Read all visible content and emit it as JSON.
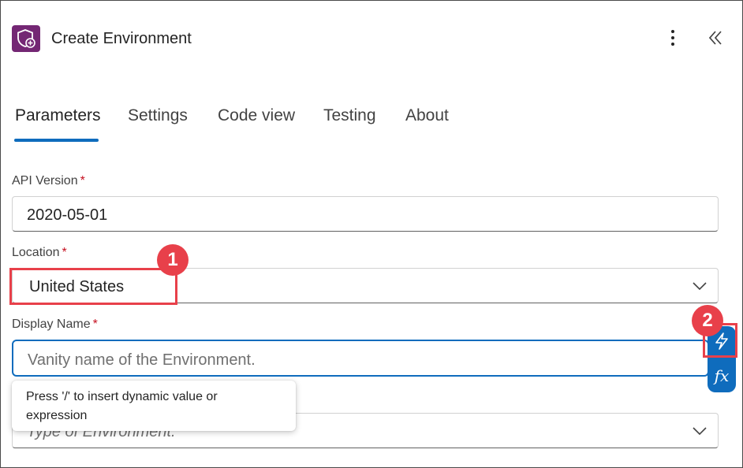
{
  "header": {
    "title": "Create Environment",
    "icon": "shield-add-icon",
    "more_icon": "more-vertical-icon",
    "collapse_icon": "double-chevron-left-icon"
  },
  "tabs": [
    {
      "label": "Parameters",
      "active": true
    },
    {
      "label": "Settings",
      "active": false
    },
    {
      "label": "Code view",
      "active": false
    },
    {
      "label": "Testing",
      "active": false
    },
    {
      "label": "About",
      "active": false
    }
  ],
  "fields": {
    "api_version": {
      "label": "API Version",
      "required": "*",
      "value": "2020-05-01"
    },
    "location": {
      "label": "Location",
      "required": "*",
      "value": "United States"
    },
    "display_name": {
      "label": "Display Name",
      "required": "*",
      "placeholder": "Vanity name of the Environment."
    },
    "environment_type": {
      "placeholder": "Type of Environment."
    }
  },
  "tooltip": {
    "text": "Press '/' to insert dynamic value or expression"
  },
  "annotations": {
    "badge_1": "1",
    "badge_2": "2"
  },
  "colors": {
    "accent": "#0f6cbd",
    "brand_icon": "#742774",
    "annotation": "#e8404a",
    "required": "#c50f1f"
  }
}
